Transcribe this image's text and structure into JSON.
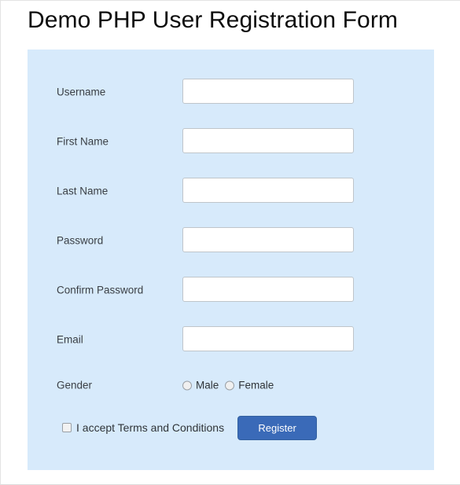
{
  "page": {
    "title": "Demo PHP User Registration Form",
    "background_color": "#ffffff",
    "panel_color": "#d7eafb"
  },
  "form": {
    "fields": [
      {
        "label": "Username",
        "value": "",
        "placeholder": "",
        "type": "text"
      },
      {
        "label": "First Name",
        "value": "",
        "placeholder": "",
        "type": "text"
      },
      {
        "label": "Last Name",
        "value": "",
        "placeholder": "",
        "type": "text"
      },
      {
        "label": "Password",
        "value": "",
        "placeholder": "",
        "type": "password"
      },
      {
        "label": "Confirm Password",
        "value": "",
        "placeholder": "",
        "type": "password"
      },
      {
        "label": "Email",
        "value": "",
        "placeholder": "",
        "type": "text"
      }
    ],
    "gender": {
      "label": "Gender",
      "options": [
        {
          "label": "Male",
          "selected": false
        },
        {
          "label": "Female",
          "selected": false
        }
      ]
    },
    "terms": {
      "label": "I accept Terms and Conditions",
      "checked": false
    },
    "submit": {
      "label": "Register",
      "color": "#3a6ab8",
      "text_color": "#ffffff"
    }
  }
}
